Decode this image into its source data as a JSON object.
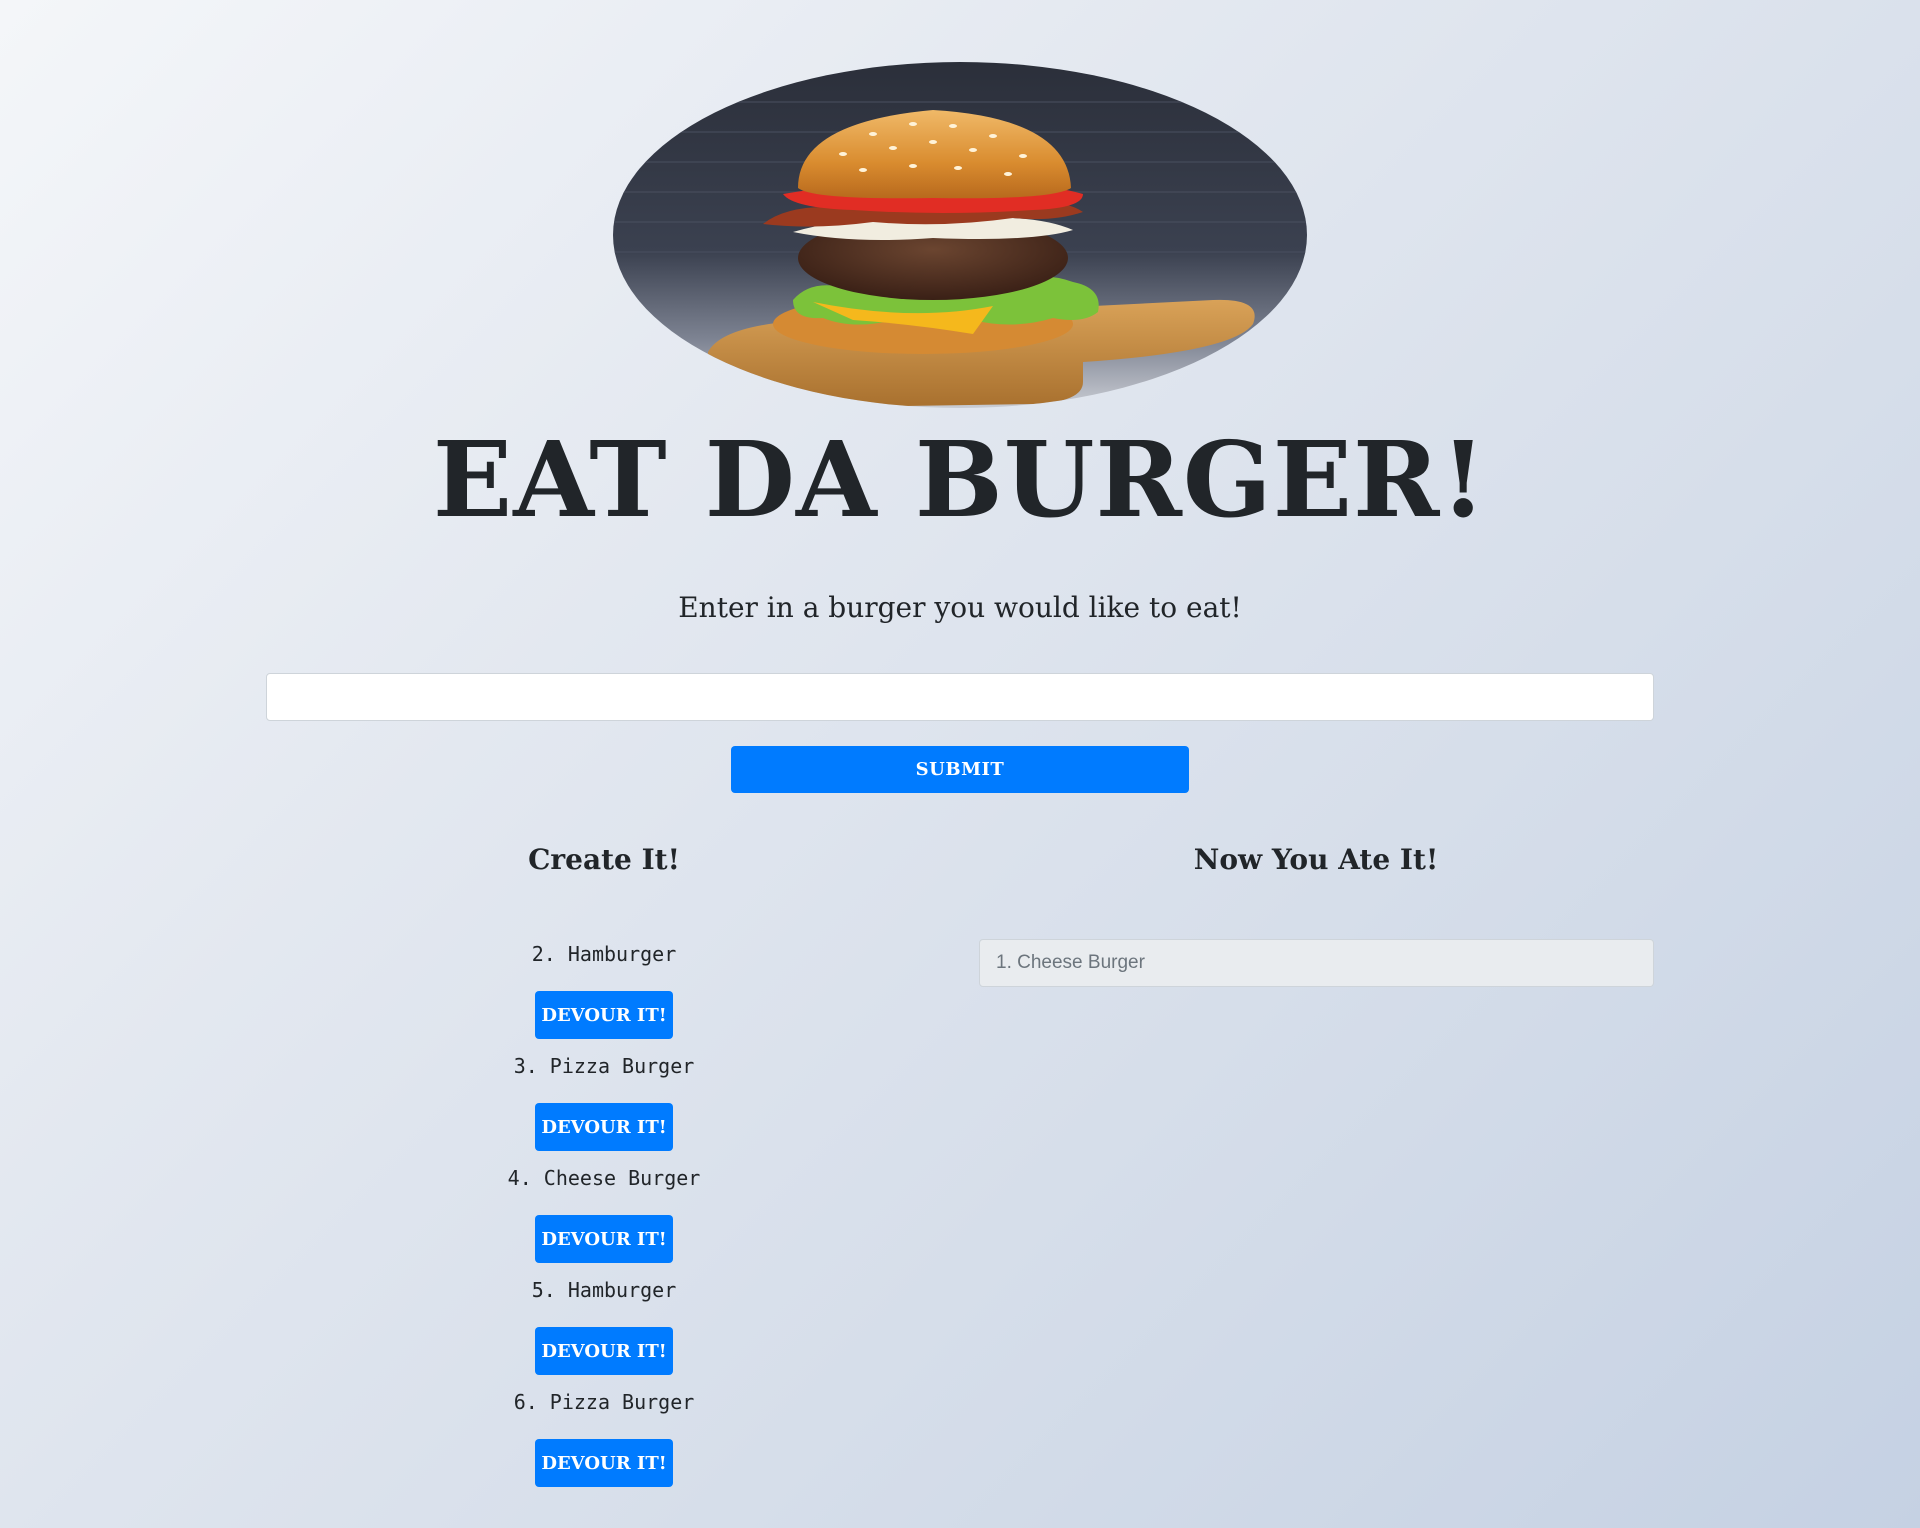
{
  "header": {
    "image_alt": "burger photo",
    "title": "EAT DA BURGER!",
    "subtitle": "Enter in a burger you would like to eat!"
  },
  "form": {
    "input_value": "",
    "input_placeholder": "",
    "submit_label": "SUBMIT"
  },
  "create_column": {
    "title": "Create It!",
    "items": [
      {
        "label": "2. Hamburger",
        "button_label": "DEVOUR IT!"
      },
      {
        "label": "3. Pizza Burger",
        "button_label": "DEVOUR IT!"
      },
      {
        "label": "4. Cheese Burger",
        "button_label": "DEVOUR IT!"
      },
      {
        "label": "5. Hamburger",
        "button_label": "DEVOUR IT!"
      },
      {
        "label": "6. Pizza Burger",
        "button_label": "DEVOUR IT!"
      }
    ]
  },
  "eaten_column": {
    "title": "Now You Ate It!",
    "items": [
      {
        "label": "1. Cheese Burger"
      }
    ]
  },
  "colors": {
    "accent": "#007bff",
    "text": "#212529",
    "eaten_bg": "#e9ecef",
    "eaten_text": "#6c757d"
  }
}
